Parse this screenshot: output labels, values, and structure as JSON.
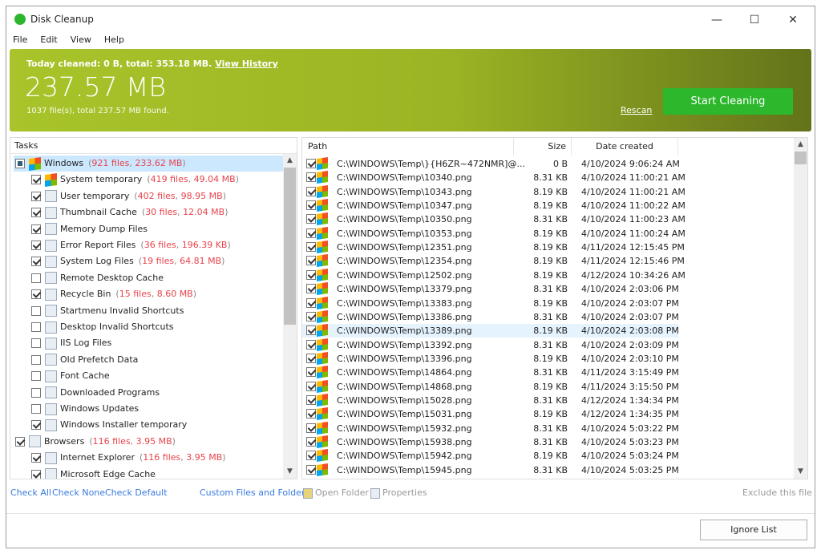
{
  "window": {
    "title": "Disk Cleanup",
    "minimize": "—",
    "maximize": "☐",
    "close": "✕"
  },
  "menu": [
    "File",
    "Edit",
    "View",
    "Help"
  ],
  "banner": {
    "today": "Today cleaned: 0 B, total: 353.18 MB.",
    "history": "View History",
    "size": "237.57 MB",
    "found": "1037 file(s), total 237.57 MB found.",
    "rescan": "Rescan",
    "start": "Start Cleaning",
    "color": "#a8c42a"
  },
  "tasks": {
    "header": "Tasks",
    "items": [
      {
        "label": "Windows",
        "files": "921 files",
        "size": "233.62 MB",
        "state": "part",
        "level": 0,
        "selected": true,
        "icon": "windows-icon"
      },
      {
        "label": "System temporary",
        "files": "419 files",
        "size": "49.04 MB",
        "state": "on",
        "level": 1,
        "icon": "windows-icon"
      },
      {
        "label": "User temporary",
        "files": "402 files",
        "size": "98.95 MB",
        "state": "on",
        "level": 1,
        "icon": "user-temp-icon"
      },
      {
        "label": "Thumbnail Cache",
        "files": "30 files",
        "size": "12.04 MB",
        "state": "on",
        "level": 1,
        "icon": "thumbnail-icon"
      },
      {
        "label": "Memory Dump Files",
        "state": "on",
        "level": 1,
        "icon": "memory-dump-icon"
      },
      {
        "label": "Error Report Files",
        "files": "36 files",
        "size": "196.39 KB",
        "state": "on",
        "level": 1,
        "icon": "error-report-icon"
      },
      {
        "label": "System Log Files",
        "files": "19 files",
        "size": "64.81 MB",
        "state": "on",
        "level": 1,
        "icon": "log-icon"
      },
      {
        "label": "Remote Desktop Cache",
        "state": "off",
        "level": 1,
        "icon": "remote-desktop-icon"
      },
      {
        "label": "Recycle Bin",
        "files": "15 files",
        "size": "8.60 MB",
        "state": "on",
        "level": 1,
        "icon": "recycle-bin-icon"
      },
      {
        "label": "Startmenu Invalid Shortcuts",
        "state": "off",
        "level": 1,
        "icon": "shortcut-icon"
      },
      {
        "label": "Desktop Invalid Shortcuts",
        "state": "off",
        "level": 1,
        "icon": "shortcut-icon"
      },
      {
        "label": "IIS Log Files",
        "state": "off",
        "level": 1,
        "icon": "log-icon"
      },
      {
        "label": "Old Prefetch Data",
        "state": "off",
        "level": 1,
        "icon": "prefetch-icon"
      },
      {
        "label": "Font Cache",
        "state": "off",
        "level": 1,
        "icon": "font-icon"
      },
      {
        "label": "Downloaded Programs",
        "state": "off",
        "level": 1,
        "icon": "download-icon"
      },
      {
        "label": "Windows Updates",
        "state": "off",
        "level": 1,
        "icon": "update-icon"
      },
      {
        "label": "Windows Installer temporary",
        "state": "on",
        "level": 1,
        "icon": "installer-icon"
      },
      {
        "label": "Browsers",
        "files": "116 files",
        "size": "3.95 MB",
        "state": "on",
        "level": 0,
        "icon": "globe-icon"
      },
      {
        "label": "Internet Explorer",
        "files": "116 files",
        "size": "3.95 MB",
        "state": "on",
        "level": 1,
        "icon": "ie-icon"
      },
      {
        "label": "Microsoft Edge Cache",
        "state": "on",
        "level": 1,
        "icon": "edge-icon"
      }
    ]
  },
  "files": {
    "columns": [
      "Path",
      "Size",
      "Date created"
    ],
    "rows": [
      [
        "C:\\WINDOWS\\Temp\\}{H6ZR~472NMR]@...",
        "0 B",
        "4/10/2024 9:06:24 AM"
      ],
      [
        "C:\\WINDOWS\\Temp\\10340.png",
        "8.31 KB",
        "4/10/2024 11:00:21 AM"
      ],
      [
        "C:\\WINDOWS\\Temp\\10343.png",
        "8.19 KB",
        "4/10/2024 11:00:21 AM"
      ],
      [
        "C:\\WINDOWS\\Temp\\10347.png",
        "8.19 KB",
        "4/10/2024 11:00:22 AM"
      ],
      [
        "C:\\WINDOWS\\Temp\\10350.png",
        "8.31 KB",
        "4/10/2024 11:00:23 AM"
      ],
      [
        "C:\\WINDOWS\\Temp\\10353.png",
        "8.19 KB",
        "4/10/2024 11:00:24 AM"
      ],
      [
        "C:\\WINDOWS\\Temp\\12351.png",
        "8.19 KB",
        "4/11/2024 12:15:45 PM"
      ],
      [
        "C:\\WINDOWS\\Temp\\12354.png",
        "8.19 KB",
        "4/11/2024 12:15:46 PM"
      ],
      [
        "C:\\WINDOWS\\Temp\\12502.png",
        "8.19 KB",
        "4/12/2024 10:34:26 AM"
      ],
      [
        "C:\\WINDOWS\\Temp\\13379.png",
        "8.31 KB",
        "4/10/2024 2:03:06 PM"
      ],
      [
        "C:\\WINDOWS\\Temp\\13383.png",
        "8.19 KB",
        "4/10/2024 2:03:07 PM"
      ],
      [
        "C:\\WINDOWS\\Temp\\13386.png",
        "8.31 KB",
        "4/10/2024 2:03:07 PM"
      ],
      [
        "C:\\WINDOWS\\Temp\\13389.png",
        "8.19 KB",
        "4/10/2024 2:03:08 PM"
      ],
      [
        "C:\\WINDOWS\\Temp\\13392.png",
        "8.31 KB",
        "4/10/2024 2:03:09 PM"
      ],
      [
        "C:\\WINDOWS\\Temp\\13396.png",
        "8.19 KB",
        "4/10/2024 2:03:10 PM"
      ],
      [
        "C:\\WINDOWS\\Temp\\14864.png",
        "8.31 KB",
        "4/11/2024 3:15:49 PM"
      ],
      [
        "C:\\WINDOWS\\Temp\\14868.png",
        "8.19 KB",
        "4/11/2024 3:15:50 PM"
      ],
      [
        "C:\\WINDOWS\\Temp\\15028.png",
        "8.31 KB",
        "4/12/2024 1:34:34 PM"
      ],
      [
        "C:\\WINDOWS\\Temp\\15031.png",
        "8.19 KB",
        "4/12/2024 1:34:35 PM"
      ],
      [
        "C:\\WINDOWS\\Temp\\15932.png",
        "8.31 KB",
        "4/10/2024 5:03:22 PM"
      ],
      [
        "C:\\WINDOWS\\Temp\\15938.png",
        "8.31 KB",
        "4/10/2024 5:03:23 PM"
      ],
      [
        "C:\\WINDOWS\\Temp\\15942.png",
        "8.19 KB",
        "4/10/2024 5:03:24 PM"
      ],
      [
        "C:\\WINDOWS\\Temp\\15945.png",
        "8.31 KB",
        "4/10/2024 5:03:25 PM"
      ]
    ],
    "highlighted_row": 12
  },
  "actions": {
    "check_all": "Check All",
    "check_none": "Check None",
    "check_default": "Check Default",
    "custom": "Custom Files and Folders",
    "open_folder": "Open Folder",
    "properties": "Properties",
    "exclude": "Exclude this file",
    "ignore_list": "Ignore List"
  }
}
